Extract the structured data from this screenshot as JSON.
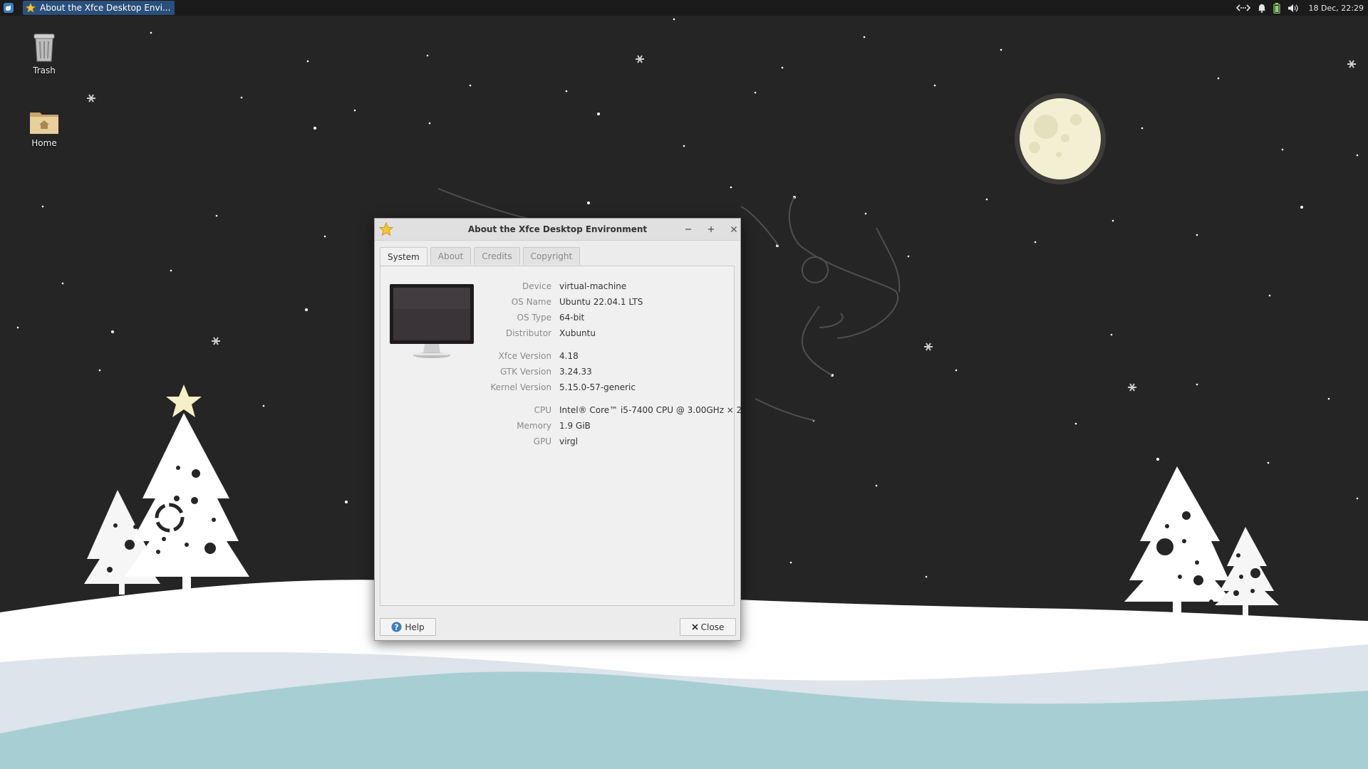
{
  "panel": {
    "taskbar_item_label": "About the Xfce Desktop Envi...",
    "clock": "18 Dec, 22:29"
  },
  "desktop": {
    "icons": [
      {
        "label": "Trash",
        "icon": "trash-icon"
      },
      {
        "label": "Home",
        "icon": "home-folder-icon"
      }
    ]
  },
  "dialog": {
    "title": "About the Xfce Desktop Environment",
    "tabs": [
      {
        "label": "System",
        "active": true
      },
      {
        "label": "About",
        "active": false
      },
      {
        "label": "Credits",
        "active": false
      },
      {
        "label": "Copyright",
        "active": false
      }
    ],
    "info": [
      {
        "label": "Device",
        "value": "virtual-machine"
      },
      {
        "label": "OS Name",
        "value": "Ubuntu 22.04.1 LTS"
      },
      {
        "label": "OS Type",
        "value": "64-bit"
      },
      {
        "label": "Distributor",
        "value": "Xubuntu"
      },
      {
        "label": "Xfce Version",
        "value": "4.18"
      },
      {
        "label": "GTK Version",
        "value": "3.24.33"
      },
      {
        "label": "Kernel Version",
        "value": "5.15.0-57-generic"
      },
      {
        "label": "CPU",
        "value": "Intel® Core™ i5-7400 CPU @ 3.00GHz × 2"
      },
      {
        "label": "Memory",
        "value": "1.9 GiB"
      },
      {
        "label": "GPU",
        "value": "virgl"
      }
    ],
    "help_label": "Help",
    "close_label": "Close"
  },
  "colors": {
    "sky": "#252525",
    "moon": "#f3efd2",
    "snow": "#ffffff",
    "water": "#a7cfd3",
    "taskbar_active": "#2b4f7a"
  }
}
